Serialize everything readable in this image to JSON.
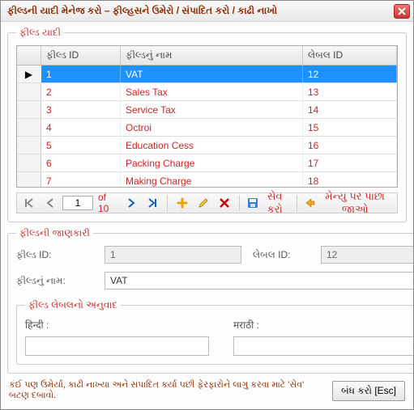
{
  "window": {
    "title": "ફીલ્ડની યાદી મેનેજ કરો – ફીલ્હસને ઉમેરો / સંપાદિત કરો / કાઢી નાખો"
  },
  "list": {
    "legend": "ફીલ્ડ યાદી",
    "headers": {
      "id": "ફીલ્ડ ID",
      "name": "ફીલ્ડનું નામ",
      "label_id": "લેબલ ID"
    },
    "rows": [
      {
        "id": "1",
        "name": "VAT",
        "label_id": "12"
      },
      {
        "id": "2",
        "name": "Sales Tax",
        "label_id": "13"
      },
      {
        "id": "3",
        "name": "Service Tax",
        "label_id": "14"
      },
      {
        "id": "4",
        "name": "Octroi",
        "label_id": "15"
      },
      {
        "id": "5",
        "name": "Education Cess",
        "label_id": "16"
      },
      {
        "id": "6",
        "name": "Packing Charge",
        "label_id": "17"
      },
      {
        "id": "7",
        "name": "Making Charge",
        "label_id": "18"
      }
    ],
    "selected_index": 0
  },
  "pager": {
    "current": "1",
    "of_text": "of 10",
    "save_text": "સેવ કરો",
    "back_text": "મેન્યુ પર પાછા જાઓ"
  },
  "info": {
    "legend": "ફીલ્ડની જાણકારી",
    "field_id_label": "ફીલ્ડ ID:",
    "field_id_value": "1",
    "label_id_label": "લેબલ ID:",
    "label_id_value": "12",
    "name_label": "ફીલ્ડનું નામ:",
    "name_value": "VAT"
  },
  "translation": {
    "legend": "ફીલ્ડ લેબલનો અનુવાદ",
    "hindi_label": "हिन्दी :",
    "marathi_label": "मराठी :",
    "hindi_value": "",
    "marathi_value": ""
  },
  "footer": {
    "note": "કંઈ પણ ઉમેર્યા, કાઢી નાખ્યા અને સંપાદિત કર્યા પછી ફેરફારોને લાગુ કરવા માટે 'સેવ' બટણ દબાવો.",
    "close_label": "બંધ કરો [Esc]"
  }
}
